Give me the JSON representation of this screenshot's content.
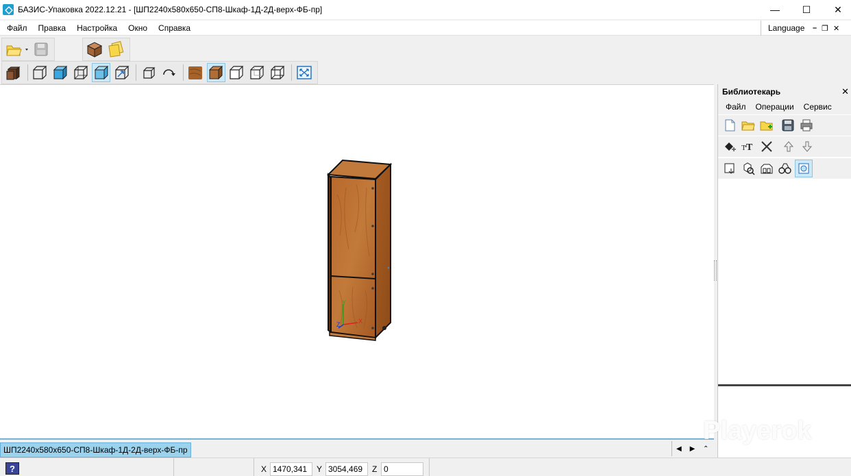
{
  "window": {
    "title": "БАЗИС-Упаковка 2022.12.21 - [ШП2240х580х650-СП8-Шкаф-1Д-2Д-верх-ФБ-пр]",
    "controls": {
      "minimize": "—",
      "maximize": "☐",
      "close": "✕"
    }
  },
  "menu": {
    "items": [
      "Файл",
      "Правка",
      "Настройка",
      "Окно",
      "Справка"
    ],
    "language": "Language",
    "mdi": {
      "minimize": "–",
      "restore": "❐",
      "close": "✕"
    }
  },
  "toolbar": {
    "top_row": [
      "open-folder-icon",
      "save-icon",
      "package-box-icon",
      "open-folders-icon"
    ],
    "bottom_row": [
      "solid-view-icon",
      "wireframe-cube-icon",
      "shaded-cube-icon",
      "hidden-lines-cube-icon",
      "transparent-cube-icon",
      "move-cube-icon",
      "rotate-view-icon",
      "orbit-icon",
      "texture-icon",
      "textured-cube-icon",
      "cube-outline-icon",
      "cube-edges-icon",
      "cube-xray-icon",
      "zoom-extents-icon"
    ],
    "colors": {
      "accent": "#1e9fd0",
      "active_bg": "#cde8f6",
      "wood": "#b86a2b"
    }
  },
  "document": {
    "tab_label": "ШП2240х580х650-СП8-Шкаф-1Д-2Д-верх-ФБ-пр",
    "nav": {
      "prev": "◀",
      "next": "▶",
      "collapse": "⌃"
    }
  },
  "axes": {
    "x": "X",
    "y": "Y",
    "z": "Z"
  },
  "status": {
    "help": "?",
    "x_label": "X",
    "x_value": "1470,341",
    "y_label": "Y",
    "y_value": "3054,469",
    "z_label": "Z",
    "z_value": "0"
  },
  "librarian": {
    "title": "Библиотекарь",
    "close": "✕",
    "menu": [
      "Файл",
      "Операции",
      "Сервис"
    ],
    "row1": [
      "new-file-icon",
      "open-folder-icon",
      "add-folder-icon",
      "save-icon",
      "print-icon"
    ],
    "row2": [
      "add-item-icon",
      "rename-text-icon",
      "cut-icon",
      "move-up-icon",
      "move-down-icon"
    ],
    "row3": [
      "insert-icon",
      "search-icon",
      "replace-icon",
      "find-icon",
      "preview-icon"
    ]
  },
  "watermark": "Playerok"
}
